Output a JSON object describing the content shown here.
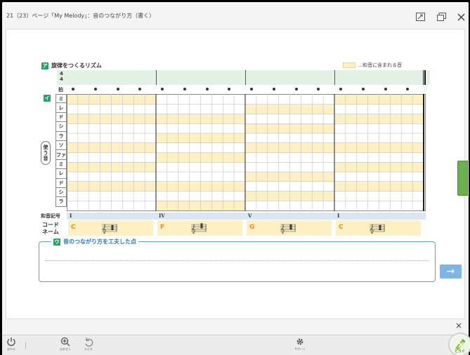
{
  "window": {
    "title": "21（23）ページ「My Melody」：音のつながり方（書く）",
    "buttons": {
      "expand_icon": "expand-icon",
      "restore_icon": "restore-icon",
      "close_icon": "close-icon"
    }
  },
  "section_a": {
    "badge": "ア",
    "title": "旋律をつくるリズム",
    "time_signature": {
      "top": "4",
      "bottom": "4"
    },
    "beat_label": "拍",
    "legend": "…和音に含まれる音"
  },
  "section_i": {
    "badge": "イ",
    "notes": [
      "ミ",
      "レ",
      "ド",
      "シ",
      "ラ",
      "ソ",
      "ファ",
      "ミ",
      "レ",
      "ド",
      "シ",
      "ラ"
    ],
    "use_label": [
      "使",
      "う",
      "音"
    ],
    "chord_symbol_label": "和音記号",
    "chord_name_label": [
      "コード",
      "ネーム"
    ],
    "chords": [
      {
        "roman": "I",
        "name": "C",
        "highlight_rows": [
          0,
          2,
          5,
          7,
          9
        ]
      },
      {
        "roman": "IV",
        "name": "F",
        "highlight_rows": [
          2,
          4,
          6,
          9,
          11
        ]
      },
      {
        "roman": "V",
        "name": "G",
        "highlight_rows": [
          1,
          3,
          5,
          8,
          10
        ]
      },
      {
        "roman": "I",
        "name": "C",
        "highlight_rows": [
          0,
          2,
          5,
          7,
          9
        ]
      }
    ]
  },
  "section_u": {
    "badge": "ウ",
    "title": "音のつながり方を工夫した点",
    "next_label": "→"
  },
  "toolbar": {
    "items": [
      {
        "label": "おわる",
        "icon": "power-icon"
      },
      {
        "label": "おおきく",
        "icon": "zoom-in-icon"
      },
      {
        "label": "もどす",
        "icon": "undo-icon"
      },
      {
        "label": "サポート",
        "icon": "gear-icon"
      }
    ],
    "next_circle_label": "どうぐ",
    "panel_close": "×"
  },
  "colors": {
    "highlight": "#fdf0c4",
    "rhythm_row": "#e3f1e6",
    "badge_green": "#2e9e6a",
    "accent_blue": "#5aa0d6",
    "chord_name": "#e88a2a",
    "side_tab": "#6ab04c"
  }
}
